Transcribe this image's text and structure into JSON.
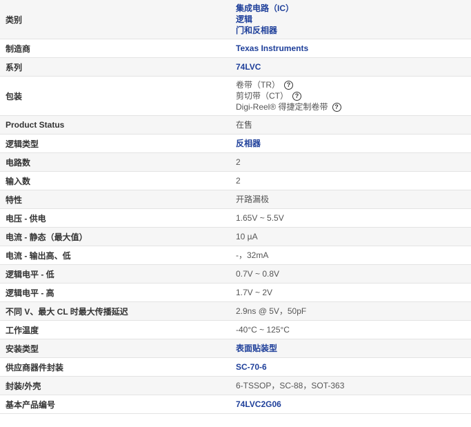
{
  "rows": [
    {
      "label": "类别",
      "values": [
        {
          "text": "集成电路（IC）",
          "link": true
        },
        {
          "text": "逻辑",
          "link": true
        },
        {
          "text": "门和反相器",
          "link": true
        }
      ]
    },
    {
      "label": "制造商",
      "values": [
        {
          "text": "Texas Instruments",
          "link": true
        }
      ]
    },
    {
      "label": "系列",
      "values": [
        {
          "text": "74LVC",
          "link": true
        }
      ]
    },
    {
      "label": "包装",
      "values": [
        {
          "text": "卷带（TR）",
          "help": true
        },
        {
          "text": "剪切带（CT）",
          "help": true
        },
        {
          "text": "Digi-Reel® 得捷定制卷带",
          "help": true
        }
      ]
    },
    {
      "label": "Product Status",
      "values": [
        {
          "text": "在售"
        }
      ]
    },
    {
      "label": "逻辑类型",
      "values": [
        {
          "text": "反相器",
          "link": true
        }
      ]
    },
    {
      "label": "电路数",
      "values": [
        {
          "text": "2"
        }
      ]
    },
    {
      "label": "输入数",
      "values": [
        {
          "text": "2"
        }
      ]
    },
    {
      "label": "特性",
      "values": [
        {
          "text": "开路漏极"
        }
      ]
    },
    {
      "label": "电压 - 供电",
      "values": [
        {
          "text": "1.65V ~ 5.5V"
        }
      ]
    },
    {
      "label": "电流 - 静态（最大值）",
      "values": [
        {
          "text": "10 µA"
        }
      ]
    },
    {
      "label": "电流 - 输出高、低",
      "values": [
        {
          "text": "-，32mA"
        }
      ]
    },
    {
      "label": "逻辑电平 - 低",
      "values": [
        {
          "text": "0.7V ~ 0.8V"
        }
      ]
    },
    {
      "label": "逻辑电平 - 高",
      "values": [
        {
          "text": "1.7V ~ 2V"
        }
      ]
    },
    {
      "label": "不同 V、最大 CL 时最大传播延迟",
      "values": [
        {
          "text": "2.9ns @ 5V，50pF"
        }
      ]
    },
    {
      "label": "工作温度",
      "values": [
        {
          "text": "-40°C ~ 125°C"
        }
      ]
    },
    {
      "label": "安装类型",
      "values": [
        {
          "text": "表面贴装型",
          "link": true
        }
      ]
    },
    {
      "label": "供应商器件封装",
      "values": [
        {
          "text": "SC-70-6",
          "link": true
        }
      ]
    },
    {
      "label": "封装/外壳",
      "values": [
        {
          "text": "6-TSSOP，SC-88，SOT-363"
        }
      ]
    },
    {
      "label": "基本产品编号",
      "values": [
        {
          "text": "74LVC2G06",
          "link": true
        }
      ]
    }
  ],
  "help_icon_glyph": "?"
}
